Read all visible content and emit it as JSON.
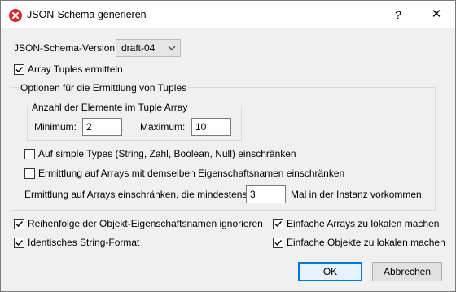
{
  "window": {
    "title": "JSON-Schema generieren",
    "help_label": "?",
    "close_label": "✕",
    "app_icon": "altova-x-icon",
    "accent_color": "#d9262a"
  },
  "schema_version": {
    "label": "JSON-Schema-Version:",
    "selected": "draft-04"
  },
  "array_tuples": {
    "label": "Array Tuples ermitteln",
    "checked": true
  },
  "tuple_options": {
    "group_title": "Optionen für die Ermittlung von Tuples",
    "element_count": {
      "group_title": "Anzahl der Elemente im Tuple Array",
      "min_label": "Minimum:",
      "min_value": "2",
      "max_label": "Maximum:",
      "max_value": "10"
    },
    "simple_types": {
      "label": "Auf simple Types (String, Zahl, Boolean, Null) einschränken",
      "checked": false
    },
    "same_property_names": {
      "label": "Ermittlung auf Arrays mit demselben Eigenschaftsnamen einschränken",
      "checked": false
    },
    "min_occurrence": {
      "label_before": "Ermittlung auf Arrays einschränken, die mindestens",
      "value": "3",
      "label_after": "Mal in der Instanz vorkommen."
    }
  },
  "options": {
    "ignore_order": {
      "label": "Reihenfolge der Objekt-Eigenschaftsnamen ignorieren",
      "checked": true
    },
    "identical_string": {
      "label": "Identisches String-Format",
      "checked": true
    },
    "simple_arrays_local": {
      "label": "Einfache Arrays zu lokalen machen",
      "checked": true
    },
    "simple_objects_local": {
      "label": "Einfache Objekte zu lokalen machen",
      "checked": true
    }
  },
  "buttons": {
    "ok": "OK",
    "cancel": "Abbrechen"
  }
}
